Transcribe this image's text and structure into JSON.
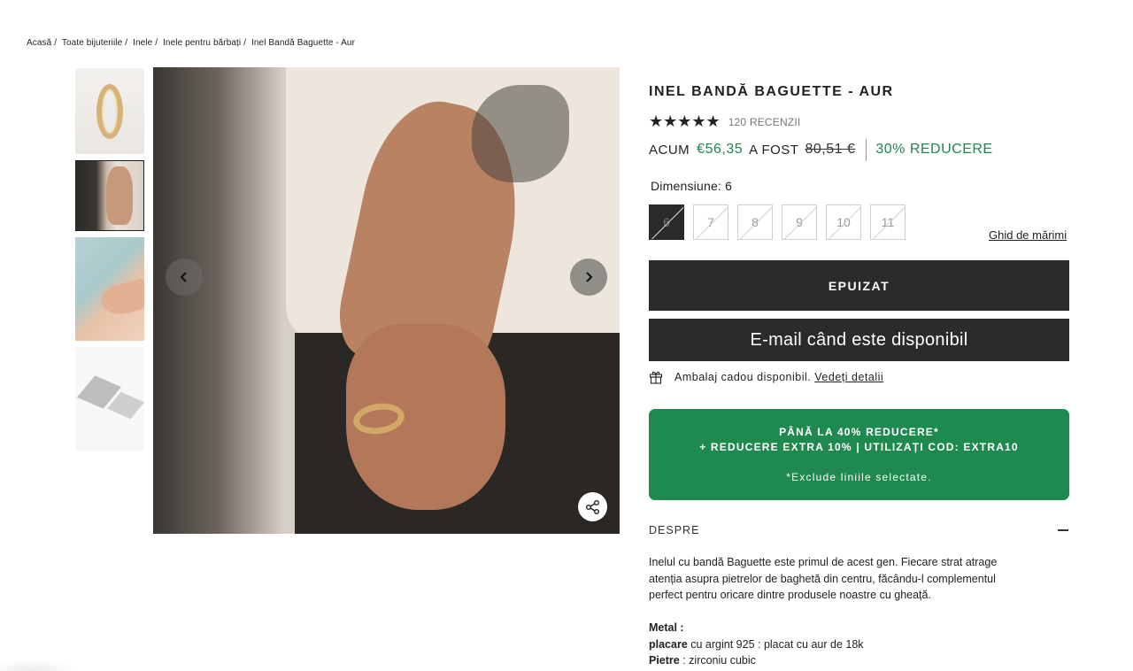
{
  "breadcrumb": [
    "Acasă",
    "Toate bijuteriile",
    "Inele",
    "Inele pentru bărbați",
    "Inel Bandă Baguette - Aur"
  ],
  "product": {
    "title": "INEL BANDĂ BAGUETTE - AUR",
    "rating_stars": "★★★★★",
    "reviews": "120 RECENZII",
    "price_now_label": "ACUM",
    "price_now": "€56,35",
    "price_was_label": "A FOST",
    "price_was": "80,51 €",
    "discount": "30% REDUCERE"
  },
  "size": {
    "label": "Dimensiune: 6",
    "options": [
      "6",
      "7",
      "8",
      "9",
      "10",
      "11"
    ],
    "selected": "6",
    "guide_link": "Ghid de mărimi"
  },
  "buttons": {
    "sold_out": "EPUIZAT",
    "notify": "E-mail când este disponibil"
  },
  "gift": {
    "text": "Ambalaj cadou disponibil.",
    "link": "Vedeți detalii"
  },
  "promo": {
    "line1": "PÂNĂ LA 40% REDUCERE*",
    "line2": "+ REDUCERE EXTRA 10% | UTILIZAȚI COD: EXTRA10",
    "line3": "*Exclude liniile selectate.",
    "color": "#1f8a4f"
  },
  "about": {
    "heading": "DESPRE",
    "description": "Inelul cu bandă Baguette este primul de acest gen. Fiecare strat atrage atenția asupra pietrelor de baghetă din centru, făcându-l complementul perfect pentru oricare dintre produsele noastre cu gheață.",
    "metal_label": "Metal :",
    "plating_label": "placare",
    "plating_value": " cu argint 925 : placat cu aur de 18k",
    "stones_label": "Pietre",
    "stones_value": " : zirconiu cubic"
  },
  "icons": {
    "prev": "chevron-left-icon",
    "next": "chevron-right-icon",
    "share": "share-icon",
    "gift": "gift-icon"
  },
  "colors": {
    "accent_green": "#1e874f",
    "button_dark": "#2b2b2b"
  }
}
